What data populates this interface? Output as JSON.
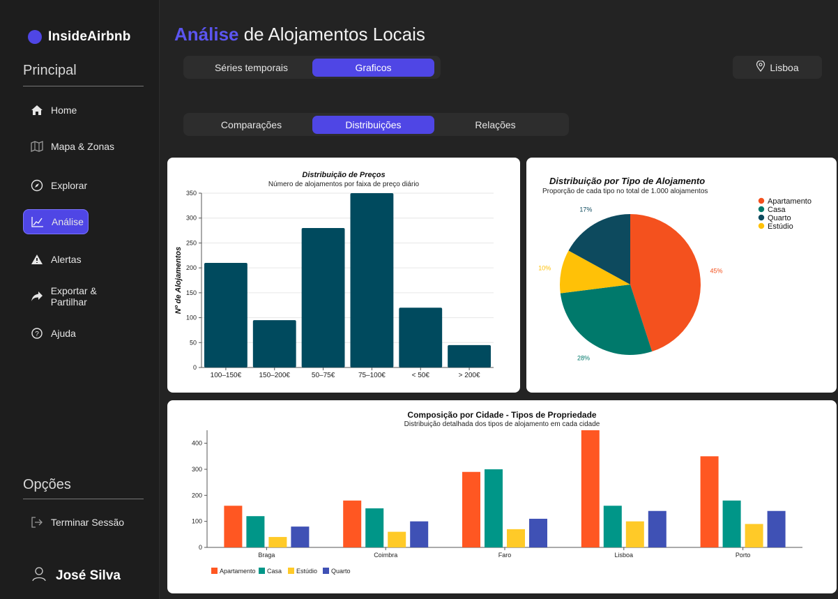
{
  "app": {
    "brand": "InsideAirbnb"
  },
  "sidebar": {
    "principal_title": "Principal",
    "items": [
      {
        "label": "Home",
        "icon": "home-icon"
      },
      {
        "label": "Mapa & Zonas",
        "icon": "map-icon"
      },
      {
        "label": "Explorar",
        "icon": "compass-icon"
      },
      {
        "label": "Análise",
        "icon": "chart-line-icon"
      },
      {
        "label": "Alertas",
        "icon": "warning-icon"
      },
      {
        "label": "Exportar & Partilhar",
        "icon": "share-icon"
      },
      {
        "label": "Ajuda",
        "icon": "help-icon"
      }
    ],
    "options_title": "Opções",
    "logout_label": "Terminar Sessão",
    "user_name": "José Silva"
  },
  "header": {
    "title_accent": "Análise",
    "title_rest": " de Alojamentos Locais",
    "view_tabs": [
      {
        "label": "Séries temporais"
      },
      {
        "label": "Graficos"
      }
    ],
    "location_label": "Lisboa",
    "chart_tabs": [
      {
        "label": "Comparações"
      },
      {
        "label": "Distribuições"
      },
      {
        "label": "Relações"
      }
    ]
  },
  "colors": {
    "accent": "#4f46e5",
    "bar_teal": "#004a5e",
    "apartamento": "#ff5722",
    "casa": "#009688",
    "estudio": "#ffca28",
    "quarto": "#3f51b5",
    "pie_apartamento": "#f4511e",
    "pie_casa": "#00796b",
    "pie_quarto": "#0d4a5e",
    "pie_estudio": "#ffc107"
  },
  "chart_data": [
    {
      "type": "bar",
      "title": "Distribuição de Preços",
      "subtitle": "Número de alojamentos por faixa de preço diário",
      "ylabel": "Nº de Alojamentos",
      "xlabel": "",
      "categories": [
        "100–150€",
        "150–200€",
        "50–75€",
        "75–100€",
        "< 50€",
        "> 200€"
      ],
      "values": [
        210,
        95,
        280,
        350,
        120,
        45
      ],
      "ylim": [
        0,
        350
      ],
      "yticks": [
        0,
        50,
        100,
        150,
        200,
        250,
        300,
        350
      ],
      "grid": true
    },
    {
      "type": "pie",
      "title": "Distribuição por Tipo de Alojamento",
      "subtitle": "Proporção de cada tipo no total de 1.000 alojamentos",
      "legend_position": "top-right",
      "slices": [
        {
          "name": "Apartamento",
          "value": 45,
          "label": "45%"
        },
        {
          "name": "Casa",
          "value": 28,
          "label": "28%"
        },
        {
          "name": "Estúdio",
          "value": 10,
          "label": "10%"
        },
        {
          "name": "Quarto",
          "value": 17,
          "label": "17%"
        }
      ],
      "legend": [
        "Apartamento",
        "Casa",
        "Quarto",
        "Estúdio"
      ]
    },
    {
      "type": "bar",
      "title": "Composição por Cidade - Tipos de Propriedade",
      "subtitle": "Distribuição detalhada dos tipos de alojamento em cada cidade",
      "xlabel": "",
      "ylabel": "",
      "categories": [
        "Braga",
        "Coimbra",
        "Faro",
        "Lisboa",
        "Porto"
      ],
      "series": [
        {
          "name": "Apartamento",
          "values": [
            160,
            180,
            290,
            450,
            350
          ]
        },
        {
          "name": "Casa",
          "values": [
            120,
            150,
            300,
            160,
            180
          ]
        },
        {
          "name": "Estúdio",
          "values": [
            40,
            60,
            70,
            100,
            90
          ]
        },
        {
          "name": "Quarto",
          "values": [
            80,
            100,
            110,
            140,
            140
          ]
        }
      ],
      "ylim": [
        0,
        450
      ],
      "yticks": [
        0,
        100,
        200,
        300,
        400
      ],
      "legend_position": "bottom-left",
      "grid": false
    }
  ]
}
